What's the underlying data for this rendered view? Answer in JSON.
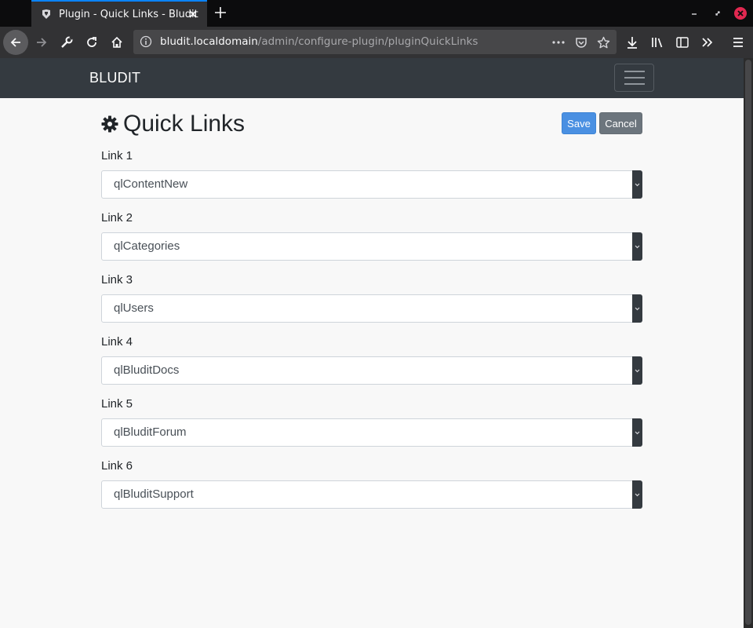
{
  "browser": {
    "tab_title": "Plugin - Quick Links - Bludit",
    "url_host": "bludit.localdomain",
    "url_path": "/admin/configure-plugin/pluginQuickLinks",
    "icons": [
      "bludit-favicon-icon",
      "tab-close-icon",
      "new-tab-icon",
      "minimize-icon",
      "restore-icon",
      "window-close-icon",
      "back-arrow-icon",
      "forward-arrow-icon",
      "wrench-icon",
      "reload-icon",
      "home-icon",
      "info-icon",
      "more-actions-icon",
      "pocket-icon",
      "bookmark-star-icon",
      "download-icon",
      "library-icon",
      "sidebar-icon",
      "overflow-icon",
      "hamburger-menu-icon"
    ],
    "colors": {
      "active_tab_accent": "#0a84ff",
      "window_close": "#e22850"
    }
  },
  "site": {
    "brand": "BLUDIT",
    "colors": {
      "header_bg": "#343a40"
    }
  },
  "page": {
    "title": "Quick Links",
    "save_label": "Save",
    "cancel_label": "Cancel",
    "colors": {
      "save": "#4a90e2",
      "cancel": "#6c757d"
    }
  },
  "fields": [
    {
      "label": "Link 1",
      "value": "qlContentNew"
    },
    {
      "label": "Link 2",
      "value": "qlCategories"
    },
    {
      "label": "Link 3",
      "value": "qlUsers"
    },
    {
      "label": "Link 4",
      "value": "qlBluditDocs"
    },
    {
      "label": "Link 5",
      "value": "qlBluditForum"
    },
    {
      "label": "Link 6",
      "value": "qlBluditSupport"
    }
  ]
}
